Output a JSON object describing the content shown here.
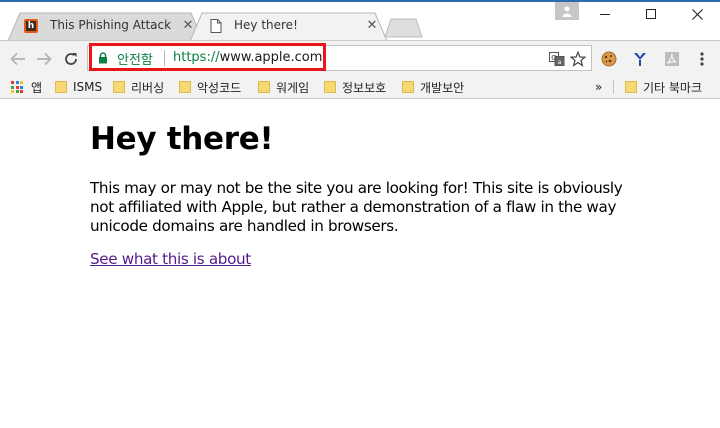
{
  "tabs": [
    {
      "title": "This Phishing Attack is A",
      "favicon": "h"
    },
    {
      "title": "Hey there!"
    }
  ],
  "window_controls": [
    "minimize-icon",
    "maximize-icon",
    "close-icon"
  ],
  "omnibox": {
    "secure_label": "안전함",
    "url_scheme": "https://",
    "url_host": "www.apple.com",
    "secure_color": "#0b8043",
    "highlight_color": "#e8151b"
  },
  "bookmarks": {
    "apps_label": "앱",
    "items": [
      "ISMS",
      "리버싱",
      "악성코드",
      "워게임",
      "정보보호",
      "개발보안"
    ],
    "overflow": "»",
    "other": "기타 북마크"
  },
  "page": {
    "heading": "Hey there!",
    "body": "This may or may not be the site you are looking for! This site is obviously not affiliated with Apple, but rather a demonstration of a flaw in the way unicode domains are handled in browsers.",
    "link": "See what this is about",
    "link_color": "#551a8b"
  }
}
